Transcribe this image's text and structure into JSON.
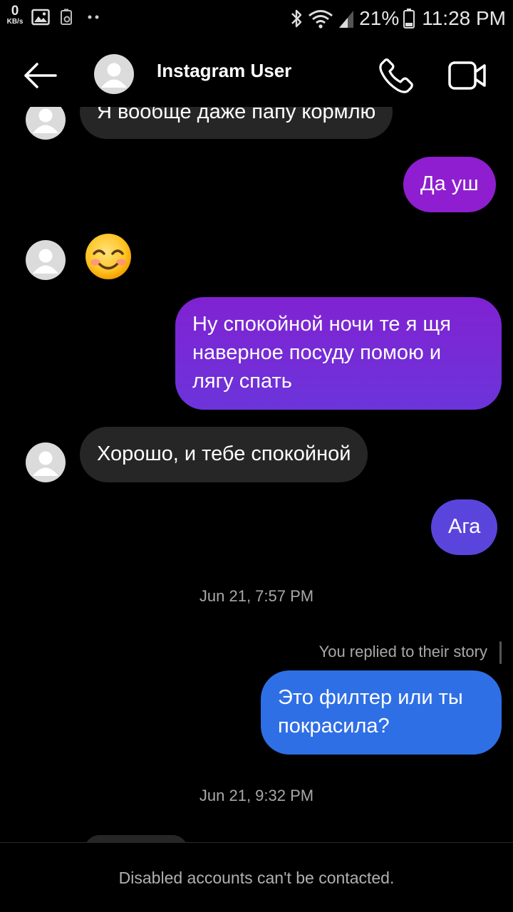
{
  "status_bar": {
    "speed_value": "0",
    "speed_unit": "KB/s",
    "battery_percent": "21%",
    "time": "11:28 PM",
    "icons": [
      "gallery-icon",
      "storage-icon",
      "more-dots-icon",
      "bluetooth-icon",
      "wifi-icon",
      "signal-icon",
      "battery-icon"
    ]
  },
  "header": {
    "title": "Instagram User",
    "icons": [
      "back-arrow-icon",
      "avatar-placeholder-icon",
      "phone-icon",
      "video-camera-icon"
    ]
  },
  "messages": [
    {
      "dir": "in",
      "text": "Я вообще даже папу кормлю",
      "partial": true
    },
    {
      "dir": "out",
      "text": "Да уш"
    },
    {
      "dir": "in",
      "emoji": "smiling-face-with-smiling-eyes-emoji"
    },
    {
      "dir": "out",
      "text": "Ну спокойной ночи те я щя наверное посуду помою и лягу спать"
    },
    {
      "dir": "in",
      "text": "Хорошо, и тебе спокойной"
    },
    {
      "dir": "out",
      "text": "Ага"
    },
    {
      "type": "timestamp",
      "text": "Jun 21, 7:57 PM"
    },
    {
      "type": "note",
      "text": "You replied to their story"
    },
    {
      "dir": "out",
      "text": "Это филтер или ты покрасила?"
    },
    {
      "type": "timestamp",
      "text": "Jun 21, 9:32 PM"
    }
  ],
  "footer": {
    "text": "Disabled accounts can't be contacted."
  },
  "colors": {
    "background": "#000000",
    "incoming_bubble": "#262626",
    "outgoing_gradient": [
      "#9c1fd1",
      "#7b2fd8",
      "#5a45e0",
      "#2f6fe6"
    ],
    "secondary_text": "#a8a8a8"
  }
}
